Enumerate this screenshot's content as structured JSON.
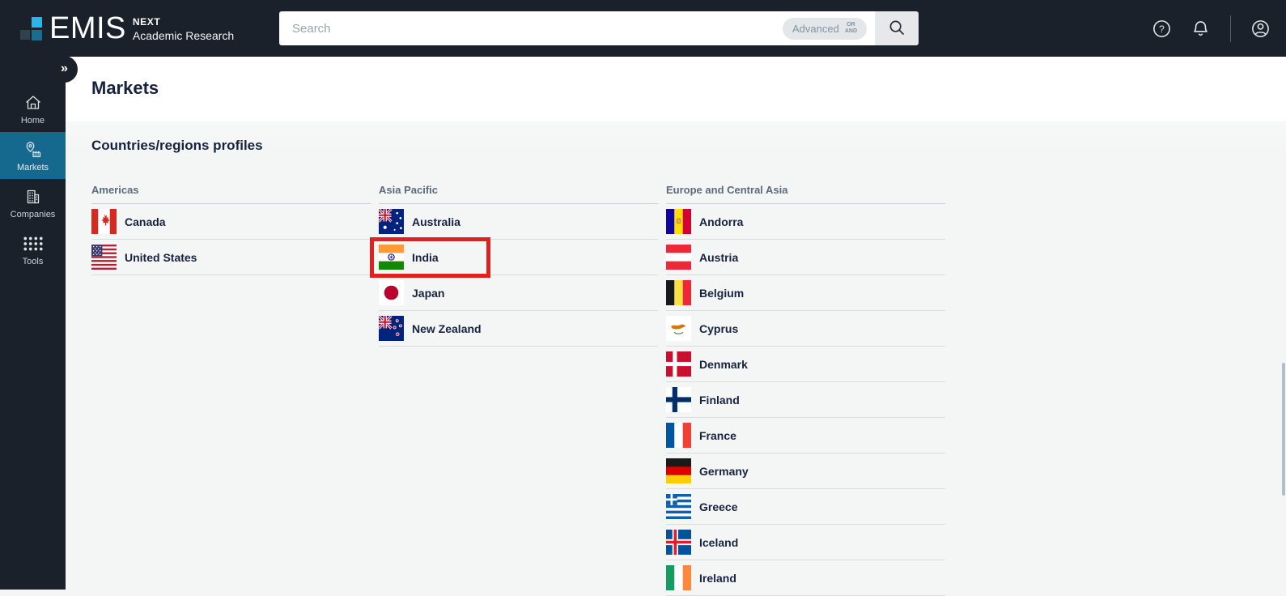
{
  "colors": {
    "header_bg": "#1b212a",
    "sidebar_bg": "#1b212a",
    "active_item_bg": "#15688e",
    "logo_cyan": "#29b5e8",
    "logo_teal": "#1a6d8e",
    "title_navy": "#17233e",
    "region_header_text": "#5a6b79",
    "row_border": "#dadde0",
    "content_bg": "#f4f5f5",
    "annotation_red": "#e12120"
  },
  "header": {
    "brand": "EMIS",
    "product": "NEXT",
    "subtitle": "Academic Research",
    "search": {
      "placeholder": "Search",
      "advanced_label": "Advanced",
      "bool_top": "OR",
      "bool_bottom": "AND"
    },
    "icons": [
      "help-icon",
      "bell-icon",
      "account-icon"
    ],
    "expand_glyph": "»"
  },
  "sidebar": {
    "items": [
      {
        "label": "Home",
        "icon": "home-icon",
        "active": false
      },
      {
        "label": "Markets",
        "icon": "markets-icon",
        "active": true
      },
      {
        "label": "Companies",
        "icon": "companies-icon",
        "active": false
      },
      {
        "label": "Tools",
        "icon": "tools-icon",
        "active": false
      }
    ]
  },
  "page": {
    "title": "Markets",
    "section_title": "Countries/regions profiles"
  },
  "regions": [
    {
      "name": "Americas",
      "countries": [
        {
          "name": "Canada",
          "flag": "ca"
        },
        {
          "name": "United States",
          "flag": "us"
        }
      ]
    },
    {
      "name": "Asia Pacific",
      "countries": [
        {
          "name": "Australia",
          "flag": "au"
        },
        {
          "name": "India",
          "flag": "in",
          "highlighted": true
        },
        {
          "name": "Japan",
          "flag": "jp"
        },
        {
          "name": "New Zealand",
          "flag": "nz"
        }
      ]
    },
    {
      "name": "Europe and Central Asia",
      "countries": [
        {
          "name": "Andorra",
          "flag": "ad"
        },
        {
          "name": "Austria",
          "flag": "at"
        },
        {
          "name": "Belgium",
          "flag": "be"
        },
        {
          "name": "Cyprus",
          "flag": "cy"
        },
        {
          "name": "Denmark",
          "flag": "dk"
        },
        {
          "name": "Finland",
          "flag": "fi"
        },
        {
          "name": "France",
          "flag": "fr"
        },
        {
          "name": "Germany",
          "flag": "de"
        },
        {
          "name": "Greece",
          "flag": "gr"
        },
        {
          "name": "Iceland",
          "flag": "is"
        },
        {
          "name": "Ireland",
          "flag": "ie"
        }
      ]
    }
  ],
  "annotation": {
    "target": "India",
    "color": "#e12120"
  }
}
